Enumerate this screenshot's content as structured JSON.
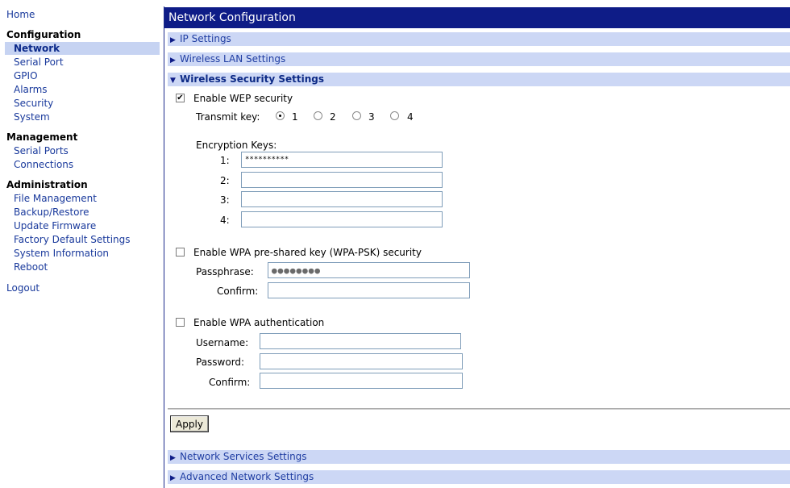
{
  "sidebar": {
    "home": "Home",
    "configuration": {
      "heading": "Configuration",
      "items": [
        "Network",
        "Serial Port",
        "GPIO",
        "Alarms",
        "Security",
        "System"
      ],
      "active": "Network"
    },
    "management": {
      "heading": "Management",
      "items": [
        "Serial Ports",
        "Connections"
      ]
    },
    "administration": {
      "heading": "Administration",
      "items": [
        "File Management",
        "Backup/Restore",
        "Update Firmware",
        "Factory Default Settings",
        "System Information",
        "Reboot"
      ]
    },
    "logout": "Logout"
  },
  "main": {
    "title": "Network Configuration",
    "sections": {
      "ip": "IP Settings",
      "wlan": "Wireless LAN Settings",
      "security": "Wireless Security Settings",
      "services": "Network Services Settings",
      "advanced": "Advanced Network Settings"
    },
    "wep": {
      "checkbox_label": "Enable WEP security",
      "checked": true,
      "transmit_key_label": "Transmit key:",
      "transmit_keys": [
        "1",
        "2",
        "3",
        "4"
      ],
      "selected_key": "1",
      "encryption_keys_label": "Encryption Keys:",
      "key_labels": [
        "1:",
        "2:",
        "3:",
        "4:"
      ],
      "key_values": [
        "**********",
        "",
        "",
        ""
      ]
    },
    "wpa_psk": {
      "checkbox_label": "Enable WPA pre-shared key (WPA-PSK) security",
      "checked": false,
      "passphrase_label": "Passphrase:",
      "passphrase_value": "●●●●●●●●",
      "confirm_label": "Confirm:",
      "confirm_value": ""
    },
    "wpa_auth": {
      "checkbox_label": "Enable WPA authentication",
      "checked": false,
      "username_label": "Username:",
      "password_label": "Password:",
      "confirm_label": "Confirm:",
      "username_value": "",
      "password_value": "",
      "confirm_value": ""
    },
    "apply_label": "Apply"
  },
  "colors": {
    "title_bar": "#0e1c87",
    "section_bar": "#ccd7f5",
    "link": "#1a3a9c",
    "active_nav_bg": "#c6d3f2"
  }
}
